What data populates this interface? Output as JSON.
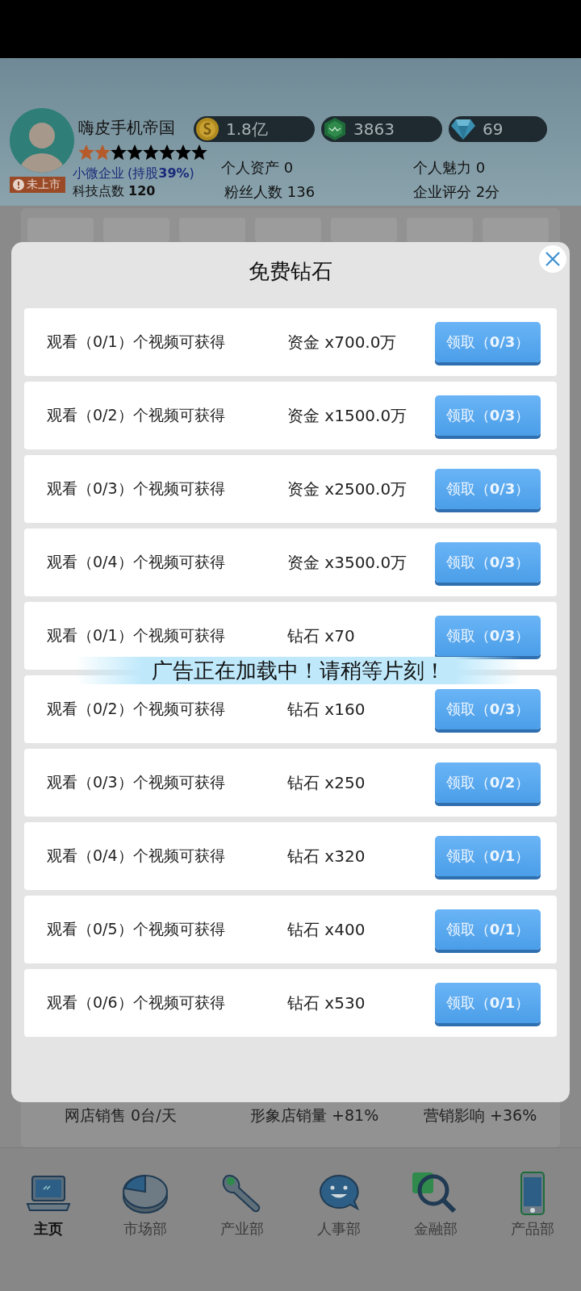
{
  "profile": {
    "name": "嗨皮手机帝国",
    "stars": 2,
    "company_type": "小微企业",
    "share": "(持股**39%**)",
    "listing_badge": "未上市",
    "tech_points": "科技点数 **120**"
  },
  "currencies": [
    {
      "kind": "coin",
      "value": "1.8亿"
    },
    {
      "kind": "gem",
      "value": "3863"
    },
    {
      "kind": "diamond",
      "value": "69"
    }
  ],
  "stats": [
    "个人资产 0",
    "个人魅力 0",
    "粉丝人数 136",
    "企业评分 2分"
  ],
  "modal": {
    "title": "免费钻石",
    "toast": "广告正在加载中！请稍等片刻！",
    "rows": [
      {
        "task": "观看（0/1）个视频可获得",
        "reward": "资金 x700.0万",
        "button": "领取（**0/3**）"
      },
      {
        "task": "观看（0/2）个视频可获得",
        "reward": "资金 x1500.0万",
        "button": "领取（**0/3**）"
      },
      {
        "task": "观看（0/3）个视频可获得",
        "reward": "资金 x2500.0万",
        "button": "领取（**0/3**）"
      },
      {
        "task": "观看（0/4）个视频可获得",
        "reward": "资金 x3500.0万",
        "button": "领取（**0/3**）"
      },
      {
        "task": "观看（0/1）个视频可获得",
        "reward": "钻石 x70",
        "button": "领取（**0/3**）"
      },
      {
        "task": "观看（0/2）个视频可获得",
        "reward": "钻石 x160",
        "button": "领取（**0/3**）"
      },
      {
        "task": "观看（0/3）个视频可获得",
        "reward": "钻石 x250",
        "button": "领取（**0/2**）"
      },
      {
        "task": "观看（0/4）个视频可获得",
        "reward": "钻石 x320",
        "button": "领取（**0/1**）"
      },
      {
        "task": "观看（0/5）个视频可获得",
        "reward": "钻石 x400",
        "button": "领取（**0/1**）"
      },
      {
        "task": "观看（0/6）个视频可获得",
        "reward": "钻石 x530",
        "button": "领取（**0/1**）"
      }
    ]
  },
  "sales_stats": [
    "网店销售 0台/天",
    "形象店销量 +81%",
    "营销影响 +36%"
  ],
  "nav": [
    {
      "kind": "laptop",
      "label": "主页",
      "selected": true
    },
    {
      "kind": "pie",
      "label": "市场部",
      "selected": false
    },
    {
      "kind": "wrench",
      "label": "产业部",
      "selected": false
    },
    {
      "kind": "chat",
      "label": "人事部",
      "selected": false
    },
    {
      "kind": "search",
      "label": "金融部",
      "selected": false
    },
    {
      "kind": "phone",
      "label": "产品部",
      "selected": false
    }
  ]
}
